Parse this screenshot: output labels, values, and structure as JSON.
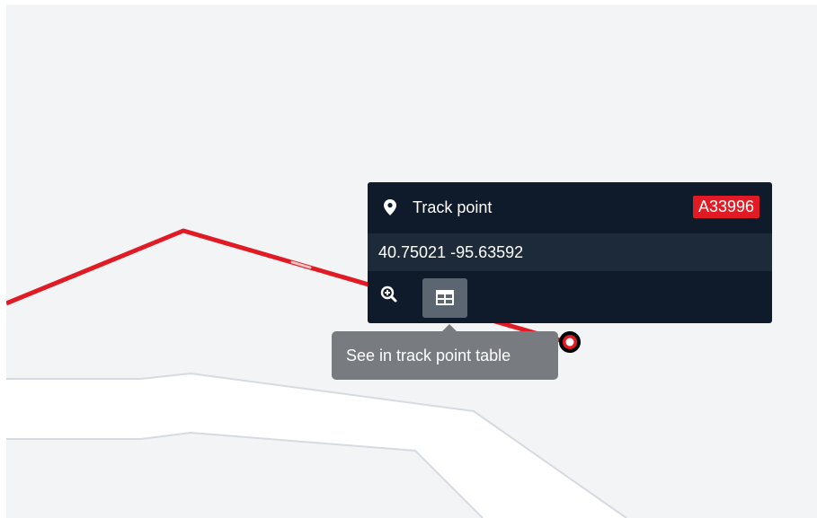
{
  "popup": {
    "title": "Track point",
    "badge": "A33996",
    "coordinates": "40.75021 -95.63592",
    "icons": {
      "location": "map-pin-icon",
      "zoom": "zoom-in-icon",
      "table": "table-icon"
    }
  },
  "tooltip": {
    "text": "See in track point table"
  },
  "colors": {
    "track": "#e01b24",
    "popup_bg": "#0f1b2a",
    "popup_row_bg": "#1c2a3a",
    "badge_bg": "#e01b24",
    "tooltip_bg": "#787c80",
    "map_bg": "#f3f4f6",
    "road": "#ffffff",
    "road_edge": "#d6dbe1"
  }
}
